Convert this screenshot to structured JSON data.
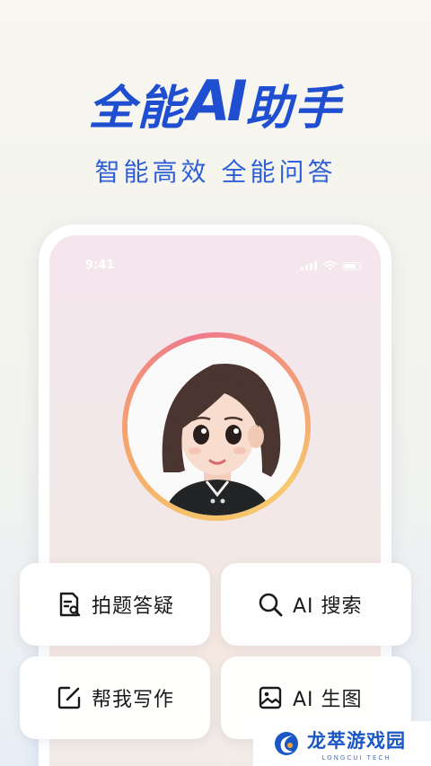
{
  "hero": {
    "title_part1": "全能",
    "title_ai": "AI",
    "title_part2": "助手",
    "subtitle": "智能高效 全能问答"
  },
  "phone": {
    "status_time": "9:41"
  },
  "features": [
    {
      "label": "拍题答疑",
      "icon": "photo-question-icon"
    },
    {
      "label": "AI 搜索",
      "icon": "search-icon"
    },
    {
      "label": "帮我写作",
      "icon": "edit-icon"
    },
    {
      "label": "AI 生图",
      "icon": "image-icon"
    }
  ],
  "watermark": {
    "brand_cn": "龙萃游戏园",
    "brand_en": "LONGCUI TECH"
  },
  "colors": {
    "brand_blue": "#1f4fd0",
    "ring_gradient": [
      "#f6c06a",
      "#ee7a8c"
    ]
  }
}
